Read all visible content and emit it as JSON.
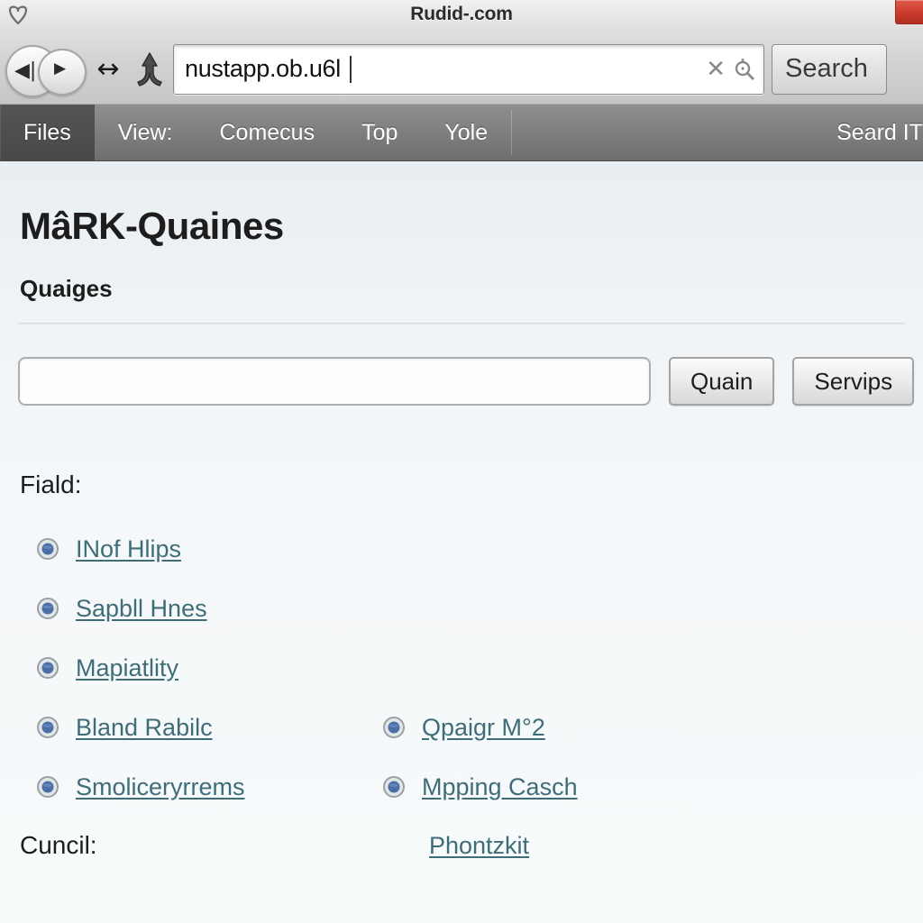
{
  "window": {
    "title": "Rudid-.com",
    "shield_icon": "shield-icon",
    "close_button_color": "#c93a2b"
  },
  "toolbar": {
    "back_glyph": "◀|",
    "forward_glyph": "▶",
    "resize_glyph": "↔",
    "anchor_icon": "anchor-icon",
    "url_value": "nustapp.ob.u6l",
    "url_clear_glyph": "✕",
    "find_icon": "magnifier-icon",
    "search_label": "Search"
  },
  "menubar": {
    "items": [
      {
        "label": "Files",
        "active": true
      },
      {
        "label": "View:",
        "active": false
      },
      {
        "label": "Comecus",
        "active": false
      },
      {
        "label": "Top",
        "active": false
      },
      {
        "label": "Yole",
        "active": false
      }
    ],
    "right_label": "Seard IT"
  },
  "page": {
    "title": "MâRK-Quaines",
    "subtitle": "Quaiges",
    "search_input_value": "",
    "buttons": [
      {
        "label": "Quain"
      },
      {
        "label": "Servips"
      }
    ],
    "field_label": "Fiald:",
    "links": [
      {
        "col1": "INof Hlips",
        "col2": ""
      },
      {
        "col1": "Sapbll Hnes",
        "col2": ""
      },
      {
        "col1": "Mapiatlity",
        "col2": ""
      },
      {
        "col1": "Bland Rabilc",
        "col2": "Qpaigr M°2"
      },
      {
        "col1": "Smoliceryrrems",
        "col2": "Mpping Casch"
      }
    ],
    "council_label": "Cuncil:",
    "council_link": "Phontzkit",
    "link_color": "#3f6d77"
  }
}
